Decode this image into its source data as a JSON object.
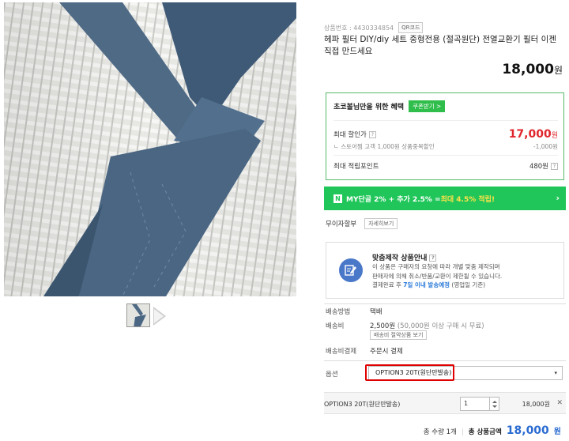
{
  "product": {
    "code_label": "상품번호 : 4430334854",
    "qr_button": "QR코드",
    "title": "헤파 필터 DIY/diy 세트 중형전용 (절곡원단) 전열교환기 필터 이젠 직접 만드세요",
    "price": "18,000",
    "price_unit": "원"
  },
  "benefit": {
    "heading": "초코볼님만을 위한 혜택",
    "coupon_button": "쿠폰받기 >",
    "max_discount_label": "최대 할인가",
    "max_discount_price": "17,000",
    "max_discount_unit": "원",
    "store_discount_label": "ㄴ 스토어찜 고객 1,000원 상품중복할인",
    "store_discount_value": "-1,000원",
    "max_points_label": "최대 적립포인트",
    "max_points_value": "480원"
  },
  "green_bar": {
    "badge": "N",
    "text_a": "MY단골 2% + 추가 2.5% = ",
    "text_b": "최대 4.5% 적립!",
    "arrow": "›"
  },
  "installment": {
    "label": "무이자할부",
    "button": "자세히보기"
  },
  "custom": {
    "title": "맞춤제작 상품안내",
    "line1": "이 상품은 구매자의 요청에 따라 개별 맞춤 제작되며",
    "line2": "판매자에 의해 취소/반품/교환이 제한될 수 있습니다.",
    "line3_a": "결제완료 후 ",
    "line3_b": "7일 이내 발송예정",
    "line3_c": " (영업일 기준)"
  },
  "shipping": {
    "method_label": "배송방법",
    "method_value": "택배",
    "fee_label": "배송비",
    "fee_value": "2,500원",
    "fee_note": " (50,000원 이상 구매 시 무료)",
    "fee_button": "배송비 절약상품 보기",
    "pay_label": "배송비결제",
    "pay_value": "주문시 결제"
  },
  "option": {
    "label": "옵션",
    "selected": "OPTION3 20T(원단만발송)",
    "caret": "▾"
  },
  "selected_item": {
    "name": "OPTION3 20T(원단만발송)",
    "quantity": "1",
    "price": "18,000원",
    "remove": "✕"
  },
  "total": {
    "count_label": "총 수량 1개",
    "amount_label": "총 상품금액",
    "amount": "18,000",
    "unit": "원"
  },
  "colors": {
    "green": "#20c659",
    "red": "#e0262d",
    "blue": "#2a6bd1"
  }
}
